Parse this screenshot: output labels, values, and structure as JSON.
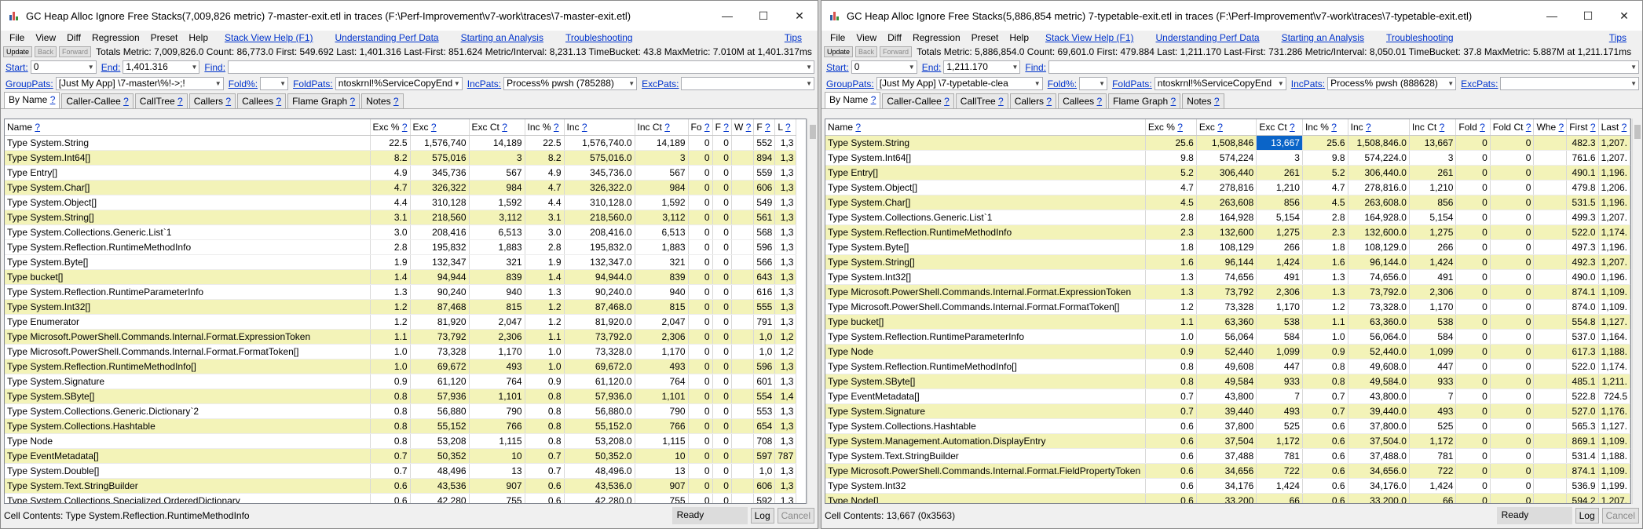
{
  "common": {
    "menu": [
      "File",
      "View",
      "Diff",
      "Regression",
      "Preset",
      "Help"
    ],
    "menu_links": [
      "Stack View Help (F1)",
      "Understanding Perf Data",
      "Starting an Analysis",
      "Troubleshooting"
    ],
    "tips": "Tips",
    "update_label": "Update",
    "back_label": "Back",
    "forward_label": "Forward",
    "start_label": "Start:",
    "end_label": "End:",
    "find_label": "Find:",
    "grouppats_label": "GroupPats:",
    "foldpct_label": "Fold%:",
    "foldpats_label": "FoldPats:",
    "incpats_label": "IncPats:",
    "excpats_label": "ExcPats:",
    "tabs": [
      "By Name",
      "Caller-Callee",
      "CallTree",
      "Callers",
      "Callees",
      "Flame Graph",
      "Notes"
    ],
    "help_mark": "?",
    "ready": "Ready",
    "log": "Log",
    "cancel": "Cancel",
    "window_buttons": {
      "minimize": "—",
      "maximize": "☐",
      "close": "✕"
    }
  },
  "left": {
    "title": "GC Heap Alloc Ignore Free Stacks(7,009,826 metric) 7-master-exit.etl in traces (F:\\Perf-Improvement\\v7-work\\traces\\7-master-exit.etl)",
    "stats": "Totals Metric: 7,009,826.0  Count: 86,773.0  First: 549.692  Last: 1,401.316  Last-First: 851.624  Metric/Interval: 8,231.13  TimeBucket: 43.8  MaxMetric: 7.010M at 1,401.317ms",
    "start": "0",
    "end": "1,401.316",
    "group_pats": "[Just My App]           \\7-master\\%!->;!",
    "fold_pct": "",
    "fold_pats": "ntoskrnl!%ServiceCopyEnd",
    "inc_pats": "Process% pwsh (785288)",
    "exc_pats": "",
    "columns": [
      "Name",
      "Exc %",
      "Exc",
      "Exc Ct",
      "Inc %",
      "Inc",
      "Inc Ct",
      "Fo",
      "F",
      "W",
      "F",
      "L"
    ],
    "rows": [
      [
        "Type System.String",
        "22.5",
        "1,576,740",
        "14,189",
        "22.5",
        "1,576,740.0",
        "14,189",
        "0",
        "0",
        "",
        "552",
        "1,3"
      ],
      [
        "Type System.Int64[]",
        "8.2",
        "575,016",
        "3",
        "8.2",
        "575,016.0",
        "3",
        "0",
        "0",
        "",
        "894",
        "1,3"
      ],
      [
        "Type Entry[]",
        "4.9",
        "345,736",
        "567",
        "4.9",
        "345,736.0",
        "567",
        "0",
        "0",
        "",
        "559",
        "1,3"
      ],
      [
        "Type System.Char[]",
        "4.7",
        "326,322",
        "984",
        "4.7",
        "326,322.0",
        "984",
        "0",
        "0",
        "",
        "606",
        "1,3"
      ],
      [
        "Type System.Object[]",
        "4.4",
        "310,128",
        "1,592",
        "4.4",
        "310,128.0",
        "1,592",
        "0",
        "0",
        "",
        "549",
        "1,3"
      ],
      [
        "Type System.String[]",
        "3.1",
        "218,560",
        "3,112",
        "3.1",
        "218,560.0",
        "3,112",
        "0",
        "0",
        "",
        "561",
        "1,3"
      ],
      [
        "Type System.Collections.Generic.List`1",
        "3.0",
        "208,416",
        "6,513",
        "3.0",
        "208,416.0",
        "6,513",
        "0",
        "0",
        "",
        "568",
        "1,3"
      ],
      [
        "Type System.Reflection.RuntimeMethodInfo",
        "2.8",
        "195,832",
        "1,883",
        "2.8",
        "195,832.0",
        "1,883",
        "0",
        "0",
        "",
        "596",
        "1,3"
      ],
      [
        "Type System.Byte[]",
        "1.9",
        "132,347",
        "321",
        "1.9",
        "132,347.0",
        "321",
        "0",
        "0",
        "",
        "566",
        "1,3"
      ],
      [
        "Type bucket[]",
        "1.4",
        "94,944",
        "839",
        "1.4",
        "94,944.0",
        "839",
        "0",
        "0",
        "",
        "643",
        "1,3"
      ],
      [
        "Type System.Reflection.RuntimeParameterInfo",
        "1.3",
        "90,240",
        "940",
        "1.3",
        "90,240.0",
        "940",
        "0",
        "0",
        "",
        "616",
        "1,3"
      ],
      [
        "Type System.Int32[]",
        "1.2",
        "87,468",
        "815",
        "1.2",
        "87,468.0",
        "815",
        "0",
        "0",
        "",
        "555",
        "1,3"
      ],
      [
        "Type Enumerator",
        "1.2",
        "81,920",
        "2,047",
        "1.2",
        "81,920.0",
        "2,047",
        "0",
        "0",
        "",
        "791",
        "1,3"
      ],
      [
        "Type Microsoft.PowerShell.Commands.Internal.Format.ExpressionToken",
        "1.1",
        "73,792",
        "2,306",
        "1.1",
        "73,792.0",
        "2,306",
        "0",
        "0",
        "",
        "1,0",
        "1,2"
      ],
      [
        "Type Microsoft.PowerShell.Commands.Internal.Format.FormatToken[]",
        "1.0",
        "73,328",
        "1,170",
        "1.0",
        "73,328.0",
        "1,170",
        "0",
        "0",
        "",
        "1,0",
        "1,2"
      ],
      [
        "Type System.Reflection.RuntimeMethodInfo[]",
        "1.0",
        "69,672",
        "493",
        "1.0",
        "69,672.0",
        "493",
        "0",
        "0",
        "",
        "596",
        "1,3"
      ],
      [
        "Type System.Signature",
        "0.9",
        "61,120",
        "764",
        "0.9",
        "61,120.0",
        "764",
        "0",
        "0",
        "",
        "601",
        "1,3"
      ],
      [
        "Type System.SByte[]",
        "0.8",
        "57,936",
        "1,101",
        "0.8",
        "57,936.0",
        "1,101",
        "0",
        "0",
        "",
        "554",
        "1,4"
      ],
      [
        "Type System.Collections.Generic.Dictionary`2",
        "0.8",
        "56,880",
        "790",
        "0.8",
        "56,880.0",
        "790",
        "0",
        "0",
        "",
        "553",
        "1,3"
      ],
      [
        "Type System.Collections.Hashtable",
        "0.8",
        "55,152",
        "766",
        "0.8",
        "55,152.0",
        "766",
        "0",
        "0",
        "",
        "654",
        "1,3"
      ],
      [
        "Type Node",
        "0.8",
        "53,208",
        "1,115",
        "0.8",
        "53,208.0",
        "1,115",
        "0",
        "0",
        "",
        "708",
        "1,3"
      ],
      [
        "Type EventMetadata[]",
        "0.7",
        "50,352",
        "10",
        "0.7",
        "50,352.0",
        "10",
        "0",
        "0",
        "",
        "597",
        "787"
      ],
      [
        "Type System.Double[]",
        "0.7",
        "48,496",
        "13",
        "0.7",
        "48,496.0",
        "13",
        "0",
        "0",
        "",
        "1,0",
        "1,3"
      ],
      [
        "Type System.Text.StringBuilder",
        "0.6",
        "43,536",
        "907",
        "0.6",
        "43,536.0",
        "907",
        "0",
        "0",
        "",
        "606",
        "1,3"
      ],
      [
        "Type System.Collections.Specialized.OrderedDictionary",
        "0.6",
        "42,280",
        "755",
        "0.6",
        "42,280.0",
        "755",
        "0",
        "0",
        "",
        "592",
        "1,3"
      ]
    ],
    "cell_contents": "Cell Contents: Type System.Reflection.RuntimeMethodInfo"
  },
  "right": {
    "title": "GC Heap Alloc Ignore Free Stacks(5,886,854 metric) 7-typetable-exit.etl in traces (F:\\Perf-Improvement\\v7-work\\traces\\7-typetable-exit.etl)",
    "stats": "Totals Metric: 5,886,854.0  Count: 69,601.0  First: 479.884  Last: 1,211.170  Last-First: 731.286  Metric/Interval: 8,050.01  TimeBucket: 37.8  MaxMetric: 5.887M at 1,211.171ms",
    "start": "0",
    "end": "1,211.170",
    "group_pats": "[Just My App]           \\7-typetable-clea",
    "fold_pct": "",
    "fold_pats": "ntoskrnl!%ServiceCopyEnd",
    "inc_pats": "Process% pwsh (888628)",
    "exc_pats": "",
    "columns": [
      "Name",
      "Exc %",
      "Exc",
      "Exc Ct",
      "Inc %",
      "Inc",
      "Inc Ct",
      "Fold",
      "Fold Ct",
      "Whe",
      "First",
      "Last"
    ],
    "rows": [
      [
        "Type System.String",
        "25.6",
        "1,508,846",
        "13,667",
        "25.6",
        "1,508,846.0",
        "13,667",
        "0",
        "0",
        "",
        "482.3",
        "1,207."
      ],
      [
        "Type System.Int64[]",
        "9.8",
        "574,224",
        "3",
        "9.8",
        "574,224.0",
        "3",
        "0",
        "0",
        "",
        "761.6",
        "1,207."
      ],
      [
        "Type Entry[]",
        "5.2",
        "306,440",
        "261",
        "5.2",
        "306,440.0",
        "261",
        "0",
        "0",
        "",
        "490.1",
        "1,196."
      ],
      [
        "Type System.Object[]",
        "4.7",
        "278,816",
        "1,210",
        "4.7",
        "278,816.0",
        "1,210",
        "0",
        "0",
        "",
        "479.8",
        "1,206."
      ],
      [
        "Type System.Char[]",
        "4.5",
        "263,608",
        "856",
        "4.5",
        "263,608.0",
        "856",
        "0",
        "0",
        "",
        "531.5",
        "1,196."
      ],
      [
        "Type System.Collections.Generic.List`1",
        "2.8",
        "164,928",
        "5,154",
        "2.8",
        "164,928.0",
        "5,154",
        "0",
        "0",
        "",
        "499.3",
        "1,207."
      ],
      [
        "Type System.Reflection.RuntimeMethodInfo",
        "2.3",
        "132,600",
        "1,275",
        "2.3",
        "132,600.0",
        "1,275",
        "0",
        "0",
        "",
        "522.0",
        "1,174."
      ],
      [
        "Type System.Byte[]",
        "1.8",
        "108,129",
        "266",
        "1.8",
        "108,129.0",
        "266",
        "0",
        "0",
        "",
        "497.3",
        "1,196."
      ],
      [
        "Type System.String[]",
        "1.6",
        "96,144",
        "1,424",
        "1.6",
        "96,144.0",
        "1,424",
        "0",
        "0",
        "",
        "492.3",
        "1,207."
      ],
      [
        "Type System.Int32[]",
        "1.3",
        "74,656",
        "491",
        "1.3",
        "74,656.0",
        "491",
        "0",
        "0",
        "",
        "490.0",
        "1,196."
      ],
      [
        "Type Microsoft.PowerShell.Commands.Internal.Format.ExpressionToken",
        "1.3",
        "73,792",
        "2,306",
        "1.3",
        "73,792.0",
        "2,306",
        "0",
        "0",
        "",
        "874.1",
        "1,109."
      ],
      [
        "Type Microsoft.PowerShell.Commands.Internal.Format.FormatToken[]",
        "1.2",
        "73,328",
        "1,170",
        "1.2",
        "73,328.0",
        "1,170",
        "0",
        "0",
        "",
        "874.0",
        "1,109."
      ],
      [
        "Type bucket[]",
        "1.1",
        "63,360",
        "538",
        "1.1",
        "63,360.0",
        "538",
        "0",
        "0",
        "",
        "554.8",
        "1,127."
      ],
      [
        "Type System.Reflection.RuntimeParameterInfo",
        "1.0",
        "56,064",
        "584",
        "1.0",
        "56,064.0",
        "584",
        "0",
        "0",
        "",
        "537.0",
        "1,164."
      ],
      [
        "Type Node",
        "0.9",
        "52,440",
        "1,099",
        "0.9",
        "52,440.0",
        "1,099",
        "0",
        "0",
        "",
        "617.3",
        "1,188."
      ],
      [
        "Type System.Reflection.RuntimeMethodInfo[]",
        "0.8",
        "49,608",
        "447",
        "0.8",
        "49,608.0",
        "447",
        "0",
        "0",
        "",
        "522.0",
        "1,174."
      ],
      [
        "Type System.SByte[]",
        "0.8",
        "49,584",
        "933",
        "0.8",
        "49,584.0",
        "933",
        "0",
        "0",
        "",
        "485.1",
        "1,211."
      ],
      [
        "Type EventMetadata[]",
        "0.7",
        "43,800",
        "7",
        "0.7",
        "43,800.0",
        "7",
        "0",
        "0",
        "",
        "522.8",
        "724.5"
      ],
      [
        "Type System.Signature",
        "0.7",
        "39,440",
        "493",
        "0.7",
        "39,440.0",
        "493",
        "0",
        "0",
        "",
        "527.0",
        "1,176."
      ],
      [
        "Type System.Collections.Hashtable",
        "0.6",
        "37,800",
        "525",
        "0.6",
        "37,800.0",
        "525",
        "0",
        "0",
        "",
        "565.3",
        "1,127."
      ],
      [
        "Type System.Management.Automation.DisplayEntry",
        "0.6",
        "37,504",
        "1,172",
        "0.6",
        "37,504.0",
        "1,172",
        "0",
        "0",
        "",
        "869.1",
        "1,109."
      ],
      [
        "Type System.Text.StringBuilder",
        "0.6",
        "37,488",
        "781",
        "0.6",
        "37,488.0",
        "781",
        "0",
        "0",
        "",
        "531.4",
        "1,188."
      ],
      [
        "Type Microsoft.PowerShell.Commands.Internal.Format.FieldPropertyToken",
        "0.6",
        "34,656",
        "722",
        "0.6",
        "34,656.0",
        "722",
        "0",
        "0",
        "",
        "874.1",
        "1,109."
      ],
      [
        "Type System.Int32",
        "0.6",
        "34,176",
        "1,424",
        "0.6",
        "34,176.0",
        "1,424",
        "0",
        "0",
        "",
        "536.9",
        "1,199."
      ],
      [
        "Type Node[]",
        "0.6",
        "33,200",
        "66",
        "0.6",
        "33,200.0",
        "66",
        "0",
        "0",
        "",
        "594.2",
        "1,207."
      ]
    ],
    "cell_contents": "Cell Contents: 13,667 (0x3563)"
  }
}
